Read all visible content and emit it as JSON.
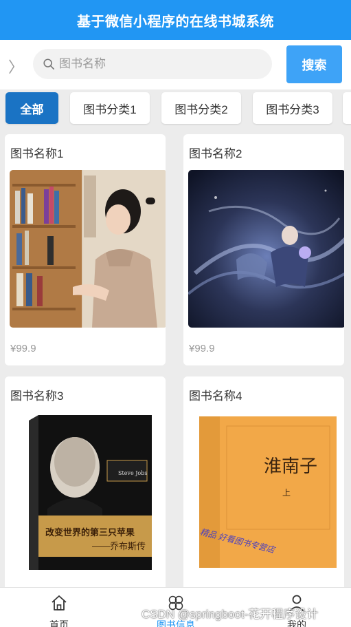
{
  "header": {
    "title": "基于微信小程序的在线书城系统"
  },
  "search": {
    "placeholder": "图书名称",
    "button_label": "搜索"
  },
  "categories": [
    {
      "label": "全部",
      "active": true
    },
    {
      "label": "图书分类1",
      "active": false
    },
    {
      "label": "图书分类2",
      "active": false
    },
    {
      "label": "图书分类3",
      "active": false
    }
  ],
  "books": [
    {
      "title": "图书名称1",
      "price": "¥99.9"
    },
    {
      "title": "图书名称2",
      "price": "¥99.9"
    },
    {
      "title": "图书名称3",
      "price": ""
    },
    {
      "title": "图书名称4",
      "price": ""
    }
  ],
  "book3_cover": {
    "main": "改变世界的第三只苹果",
    "author": "——乔布斯传",
    "logo_caption": "Steve Jobs"
  },
  "book4_cover": {
    "main": "淮南子",
    "vol": "上",
    "stamp": "精品 好看图书专营店"
  },
  "tabbar": [
    {
      "label": "首页",
      "icon": "home-icon",
      "active": false
    },
    {
      "label": "图书信息",
      "icon": "clover-icon",
      "active": true
    },
    {
      "label": "我的",
      "icon": "user-icon",
      "active": false
    }
  ],
  "watermark": "CSDN @springboot-花开程序设计",
  "colors": {
    "primary": "#2196f3",
    "active_category": "#1a73c4",
    "search_button": "#3ea3f7"
  }
}
